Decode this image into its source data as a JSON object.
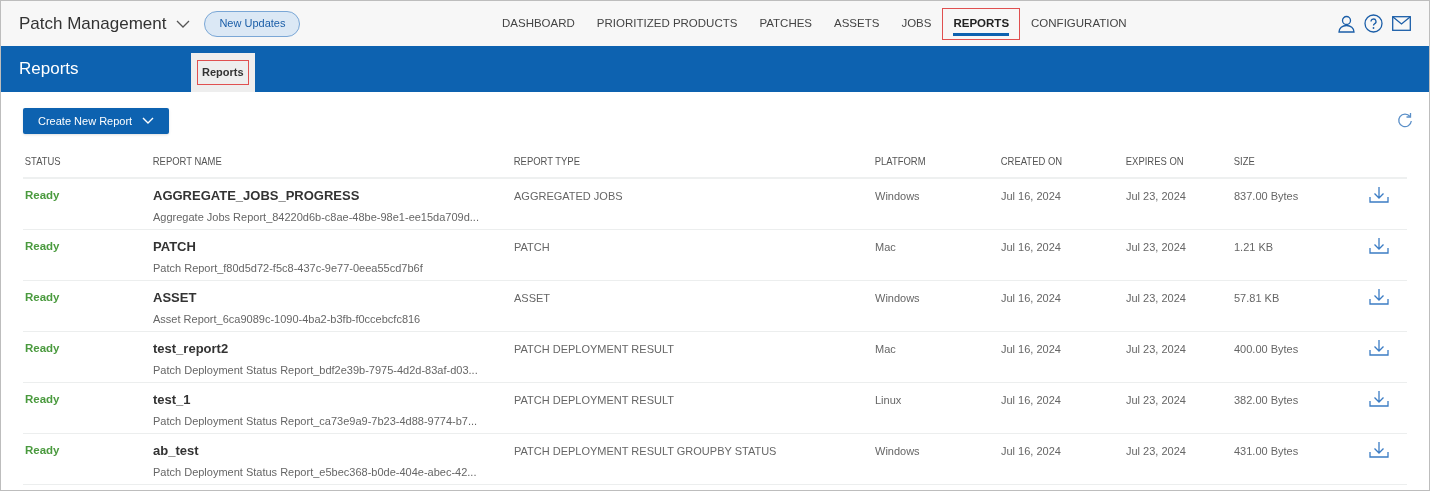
{
  "app": {
    "title": "Patch Management",
    "badge": "New Updates"
  },
  "nav": [
    {
      "label": "DASHBOARD",
      "selected": false,
      "highlighted": false
    },
    {
      "label": "PRIORITIZED PRODUCTS",
      "selected": false,
      "highlighted": false
    },
    {
      "label": "PATCHES",
      "selected": false,
      "highlighted": false
    },
    {
      "label": "ASSETS",
      "selected": false,
      "highlighted": false
    },
    {
      "label": "JOBS",
      "selected": false,
      "highlighted": false
    },
    {
      "label": "REPORTS",
      "selected": true,
      "highlighted": true
    },
    {
      "label": "CONFIGURATION",
      "selected": false,
      "highlighted": false
    }
  ],
  "page": {
    "title": "Reports",
    "tabs": [
      {
        "label": "Reports",
        "selected": true,
        "highlighted": true
      }
    ]
  },
  "create_button": "Create New Report",
  "table": {
    "columns": [
      "STATUS",
      "REPORT NAME",
      "REPORT TYPE",
      "PLATFORM",
      "CREATED ON",
      "EXPIRES ON",
      "SIZE"
    ],
    "rows": [
      {
        "status": "Ready",
        "name": "AGGREGATE_JOBS_PROGRESS",
        "file": "Aggregate Jobs Report_84220d6b-c8ae-48be-98e1-ee15da709d...",
        "type": "AGGREGATED JOBS",
        "platform": "Windows",
        "created": "Jul 16, 2024",
        "expires": "Jul 23, 2024",
        "size": "837.00 Bytes"
      },
      {
        "status": "Ready",
        "name": "PATCH",
        "file": "Patch Report_f80d5d72-f5c8-437c-9e77-0eea55cd7b6f",
        "type": "PATCH",
        "platform": "Mac",
        "created": "Jul 16, 2024",
        "expires": "Jul 23, 2024",
        "size": "1.21 KB"
      },
      {
        "status": "Ready",
        "name": "ASSET",
        "file": "Asset Report_6ca9089c-1090-4ba2-b3fb-f0ccebcfc816",
        "type": "ASSET",
        "platform": "Windows",
        "created": "Jul 16, 2024",
        "expires": "Jul 23, 2024",
        "size": "57.81 KB"
      },
      {
        "status": "Ready",
        "name": "test_report2",
        "file": "Patch Deployment Status Report_bdf2e39b-7975-4d2d-83af-d03...",
        "type": "PATCH DEPLOYMENT RESULT",
        "platform": "Mac",
        "created": "Jul 16, 2024",
        "expires": "Jul 23, 2024",
        "size": "400.00 Bytes"
      },
      {
        "status": "Ready",
        "name": "test_1",
        "file": "Patch Deployment Status Report_ca73e9a9-7b23-4d88-9774-b7...",
        "type": "PATCH DEPLOYMENT RESULT",
        "platform": "Linux",
        "created": "Jul 16, 2024",
        "expires": "Jul 23, 2024",
        "size": "382.00 Bytes"
      },
      {
        "status": "Ready",
        "name": "ab_test",
        "file": "Patch Deployment Status Report_e5bec368-b0de-404e-abec-42...",
        "type": "PATCH DEPLOYMENT RESULT GROUPBY STATUS",
        "platform": "Windows",
        "created": "Jul 16, 2024",
        "expires": "Jul 23, 2024",
        "size": "431.00 Bytes"
      }
    ]
  }
}
